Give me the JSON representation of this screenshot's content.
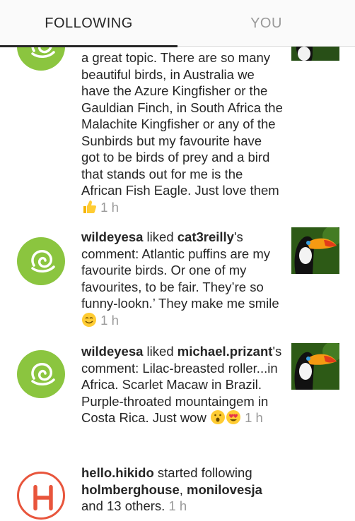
{
  "tabs": {
    "following": "FOLLOWING",
    "you": "YOU"
  },
  "items": [
    {
      "text_main": "a great topic. There are so many beautiful birds, in Australia we have the Azure Kingfisher or the Gauldian Finch, in South Africa the Malachite Kingfisher or any of the Sunbirds but my favourite have got to be birds of prey and a bird that stands out for me is the African Fish Eagle. Just love them",
      "emoji": "thumbs-up",
      "time": "1 h"
    },
    {
      "user": "wildeyesa",
      "action": " liked ",
      "target_user": "cat3reilly",
      "text_main": "'s comment: Atlantic puffins are my favourite birds. Or one of my favourites, to be fair. They’re so funny-lookn.’ They make me smile",
      "emoji": "smiling-face",
      "time": "1 h"
    },
    {
      "user": "wildeyesa",
      "action": " liked ",
      "target_user": "michael.prizant",
      "text_main": "'s comment: Lilac-breasted roller...in Africa. Scarlet Macaw in Brazil. Purple-throated mountaingem in Costa Rica. Just wow",
      "emoji": "surprised-face, heart-eyes-face",
      "time": "1 h"
    },
    {
      "user": "hello.hikido",
      "action": " started following ",
      "target_user": "holmberghouse",
      "sep": ", ",
      "target_user2": "monilovesja",
      "text_main": " and 13 others.",
      "time": "1 h"
    }
  ],
  "colors": {
    "avatar_green": "#8bc53f",
    "hello_red": "#e8553c",
    "muted": "#999999"
  }
}
